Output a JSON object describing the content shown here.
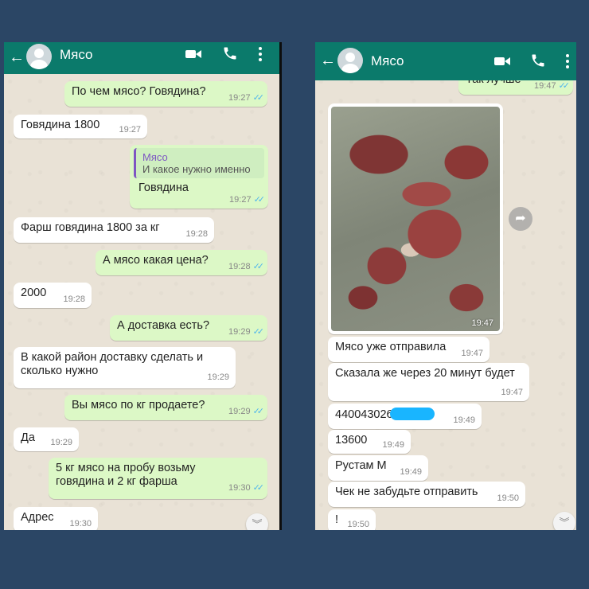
{
  "left": {
    "contact_name": "Мясо",
    "messages": [
      {
        "dir": "out",
        "text": "По чем мясо? Говядина?",
        "time": "19:27"
      },
      {
        "dir": "in",
        "text": "Говядина 1800",
        "time": "19:27"
      },
      {
        "dir": "out",
        "quote_author": "Мясо",
        "quote_text": "И какое нужно именно",
        "text": "Говядина",
        "time": "19:27"
      },
      {
        "dir": "in",
        "text": "Фарш говядина 1800 за кг",
        "time": "19:28"
      },
      {
        "dir": "out",
        "text": "А мясо какая цена?",
        "time": "19:28"
      },
      {
        "dir": "in",
        "text": "2000",
        "time": "19:28"
      },
      {
        "dir": "out",
        "text": "А доставка есть?",
        "time": "19:29"
      },
      {
        "dir": "in",
        "line1": "В какой район доставку сделать и",
        "line2": "сколько нужно",
        "time": "19:29"
      },
      {
        "dir": "out",
        "text": "Вы мясо по кг продаете?",
        "time": "19:29"
      },
      {
        "dir": "in",
        "text": "Да",
        "time": "19:29"
      },
      {
        "dir": "out",
        "line1": "5 кг мясо на пробу возьму",
        "line2": "говядина и 2 кг фарша",
        "time": "19:30"
      },
      {
        "dir": "in",
        "text": "Адрес",
        "time": "19:30"
      }
    ]
  },
  "right": {
    "contact_name": "Мясо",
    "messages": [
      {
        "dir": "out",
        "text": "Так лучше",
        "time": "19:47"
      },
      {
        "dir": "in",
        "type": "image",
        "time": "19:47"
      },
      {
        "dir": "in",
        "text": "Мясо уже отправила",
        "time": "19:47"
      },
      {
        "dir": "in",
        "text": "Сказала же через 20 минут будет",
        "time": "19:47"
      },
      {
        "dir": "in",
        "text": "440043026",
        "time": "19:49"
      },
      {
        "dir": "in",
        "text": "13600",
        "time": "19:49"
      },
      {
        "dir": "in",
        "text": "Рустам М",
        "time": "19:49"
      },
      {
        "dir": "in",
        "text": "Чек не забудьте отправить",
        "time": "19:50"
      },
      {
        "dir": "in",
        "text": "!",
        "time": "19:50"
      }
    ]
  },
  "icons": {
    "back": "arrow-left-icon",
    "video": "video-camera-icon",
    "call": "phone-icon",
    "menu": "more-vertical-icon",
    "scroll": "chevron-double-down-icon",
    "forward": "forward-arrow-icon",
    "read": "double-check-icon"
  },
  "colors": {
    "header": "#0b7a6b",
    "outgoing": "#dcf8c6",
    "incoming": "#ffffff",
    "chat_bg": "#e9e2d6",
    "read_ticks": "#4fb6ec",
    "page_bg": "#2b4665",
    "redaction": "#19b5ff"
  }
}
